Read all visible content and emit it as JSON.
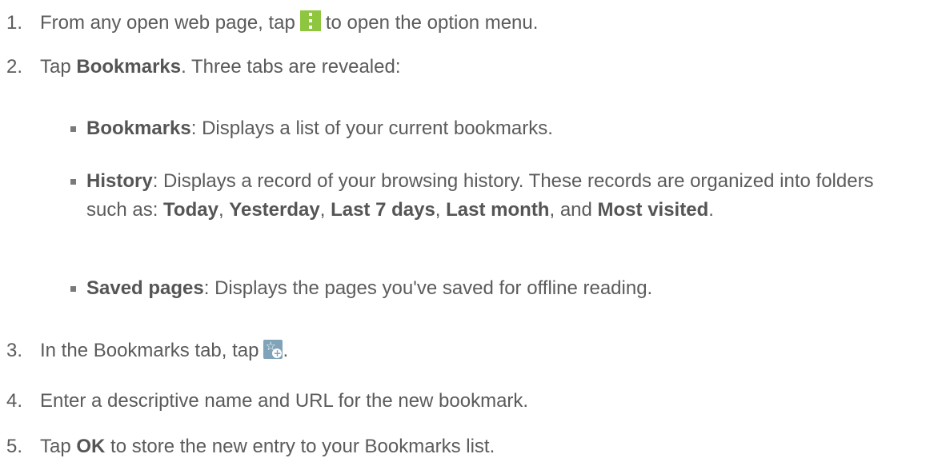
{
  "steps": [
    {
      "num": "1.",
      "pre": "From any open web page, tap",
      "post": "to open the option menu."
    },
    {
      "num": "2.",
      "pre": "Tap ",
      "bold": "Bookmarks",
      "post": ". Three tabs are revealed:"
    },
    {
      "num": "3.",
      "pre": "In the Bookmarks tab, tap",
      "post": "."
    },
    {
      "num": "4.",
      "text": "Enter a descriptive name and URL for the new bookmark."
    },
    {
      "num": "5.",
      "pre": "Tap ",
      "bold": "OK",
      "post": " to store the new entry to your Bookmarks list."
    }
  ],
  "tabs": [
    {
      "name": "Bookmarks",
      "desc": ": Displays a list of your current bookmarks."
    },
    {
      "name": "History",
      "desc": ": Displays a record of your browsing history. These records are organized into folders such as: ",
      "folders": [
        "Today",
        "Yesterday",
        "Last 7 days",
        "Last month",
        "Most visited"
      ],
      "sep": ", ",
      "and": "and ",
      "end": "."
    },
    {
      "name": "Saved pages",
      "desc": ": Displays the pages you've saved for offline reading."
    }
  ],
  "icons": {
    "option_menu": "vertical-dots-menu-icon",
    "add_bookmark": "bookmark-add-icon"
  },
  "colors": {
    "text": "#5b5b5b",
    "menu_icon_bg": "#8ec63f",
    "bookmark_icon_bg": "#7fa3b8"
  }
}
